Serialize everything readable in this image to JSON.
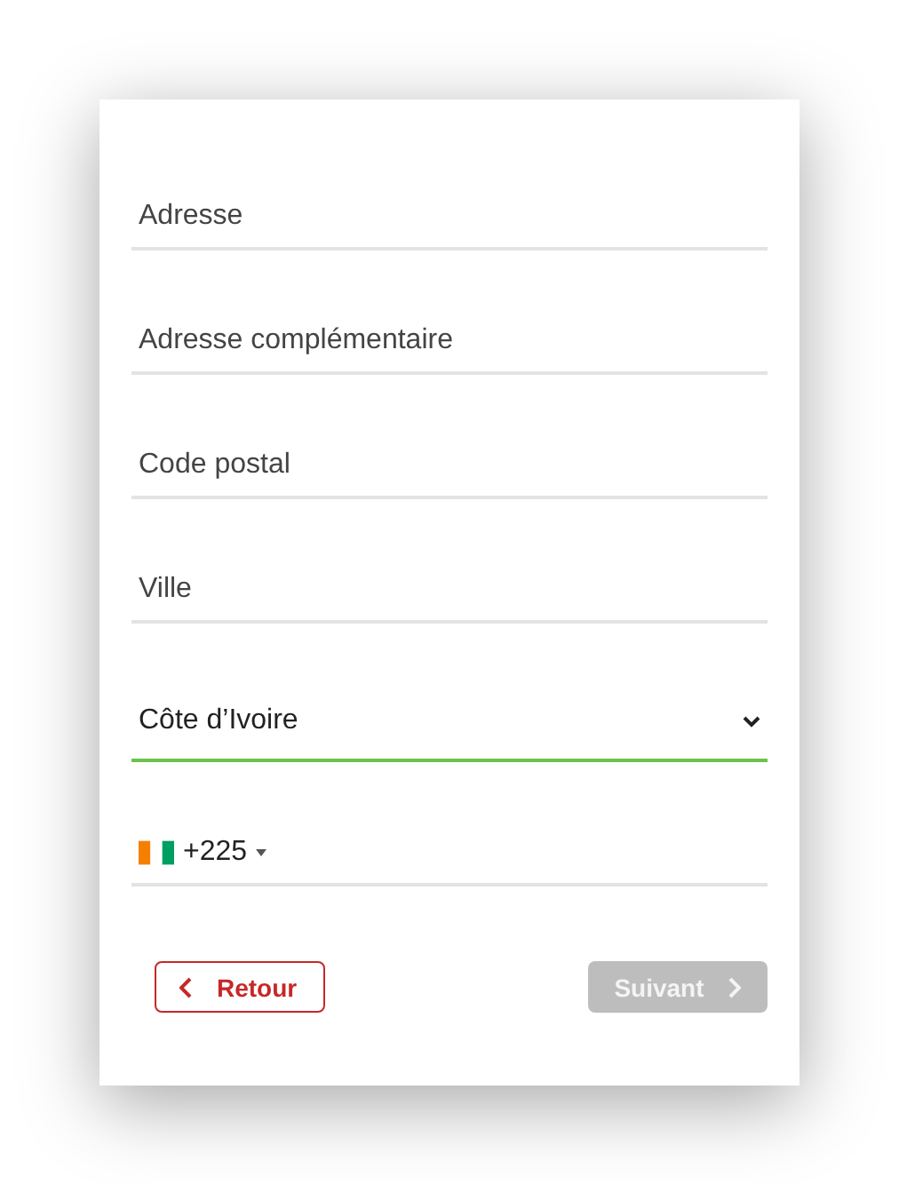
{
  "fields": [
    {
      "placeholder": "Adresse"
    },
    {
      "placeholder": "Adresse complémentaire"
    },
    {
      "placeholder": "Code postal"
    },
    {
      "placeholder": "Ville"
    }
  ],
  "country": {
    "value": "Côte d’Ivoire",
    "focused": true
  },
  "phone": {
    "dial_code": "+225"
  },
  "buttons": [
    {
      "label": "Retour",
      "kind": "back",
      "disabled": false
    },
    {
      "label": "Suivant",
      "kind": "next",
      "disabled": true
    }
  ]
}
